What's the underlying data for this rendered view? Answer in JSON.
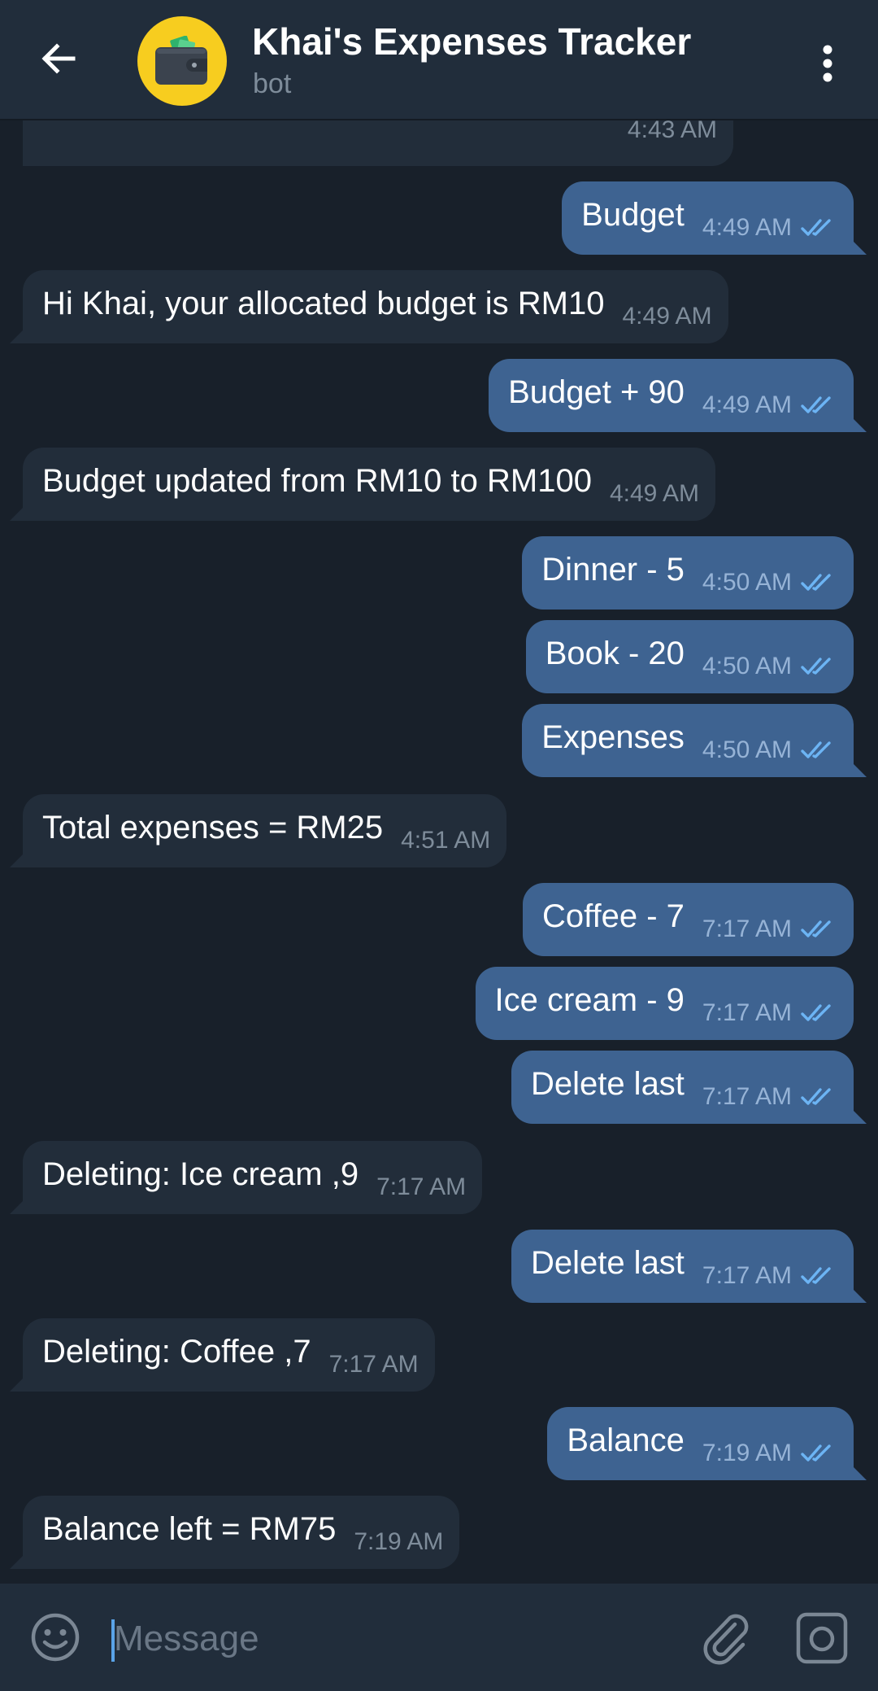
{
  "header": {
    "title": "Khai's Expenses Tracker",
    "subtitle": "bot",
    "back_icon": "arrow-left-icon",
    "avatar_icon": "wallet-icon",
    "menu_icon": "more-vert-icon",
    "avatar_color": "#f7cd1f"
  },
  "messages": [
    {
      "dir": "in",
      "text": "",
      "time": "4:43 AM"
    },
    {
      "dir": "out",
      "text": "Budget",
      "time": "4:49 AM"
    },
    {
      "dir": "in",
      "text": "Hi Khai, your allocated budget is RM10",
      "time": "4:49 AM"
    },
    {
      "dir": "out",
      "text": "Budget + 90",
      "time": "4:49 AM"
    },
    {
      "dir": "in",
      "text": "Budget updated from RM10 to RM100",
      "time": "4:49 AM"
    },
    {
      "dir": "out",
      "text": "Dinner - 5",
      "time": "4:50 AM"
    },
    {
      "dir": "out",
      "text": "Book - 20",
      "time": "4:50 AM"
    },
    {
      "dir": "out",
      "text": "Expenses",
      "time": "4:50 AM"
    },
    {
      "dir": "in",
      "text": "Total expenses = RM25",
      "time": "4:51 AM"
    },
    {
      "dir": "out",
      "text": "Coffee - 7",
      "time": "7:17 AM"
    },
    {
      "dir": "out",
      "text": "Ice cream - 9",
      "time": "7:17 AM"
    },
    {
      "dir": "out",
      "text": "Delete last",
      "time": "7:17 AM"
    },
    {
      "dir": "in",
      "text": "Deleting: Ice cream ,9",
      "time": "7:17 AM"
    },
    {
      "dir": "out",
      "text": "Delete last",
      "time": "7:17 AM"
    },
    {
      "dir": "in",
      "text": "Deleting: Coffee ,7",
      "time": "7:17 AM"
    },
    {
      "dir": "out",
      "text": "Balance",
      "time": "7:19 AM"
    },
    {
      "dir": "in",
      "text": "Balance left = RM75",
      "time": "7:19 AM"
    }
  ],
  "input": {
    "placeholder": "Message",
    "emoji_icon": "emoji-icon",
    "attach_icon": "paperclip-icon",
    "camera_icon": "camera-icon"
  },
  "colors": {
    "background": "#18202a",
    "header": "#212d3b",
    "incoming_bubble": "#222d3a",
    "outgoing_bubble": "#3e6391",
    "read_ticks": "#6cb4f4"
  }
}
